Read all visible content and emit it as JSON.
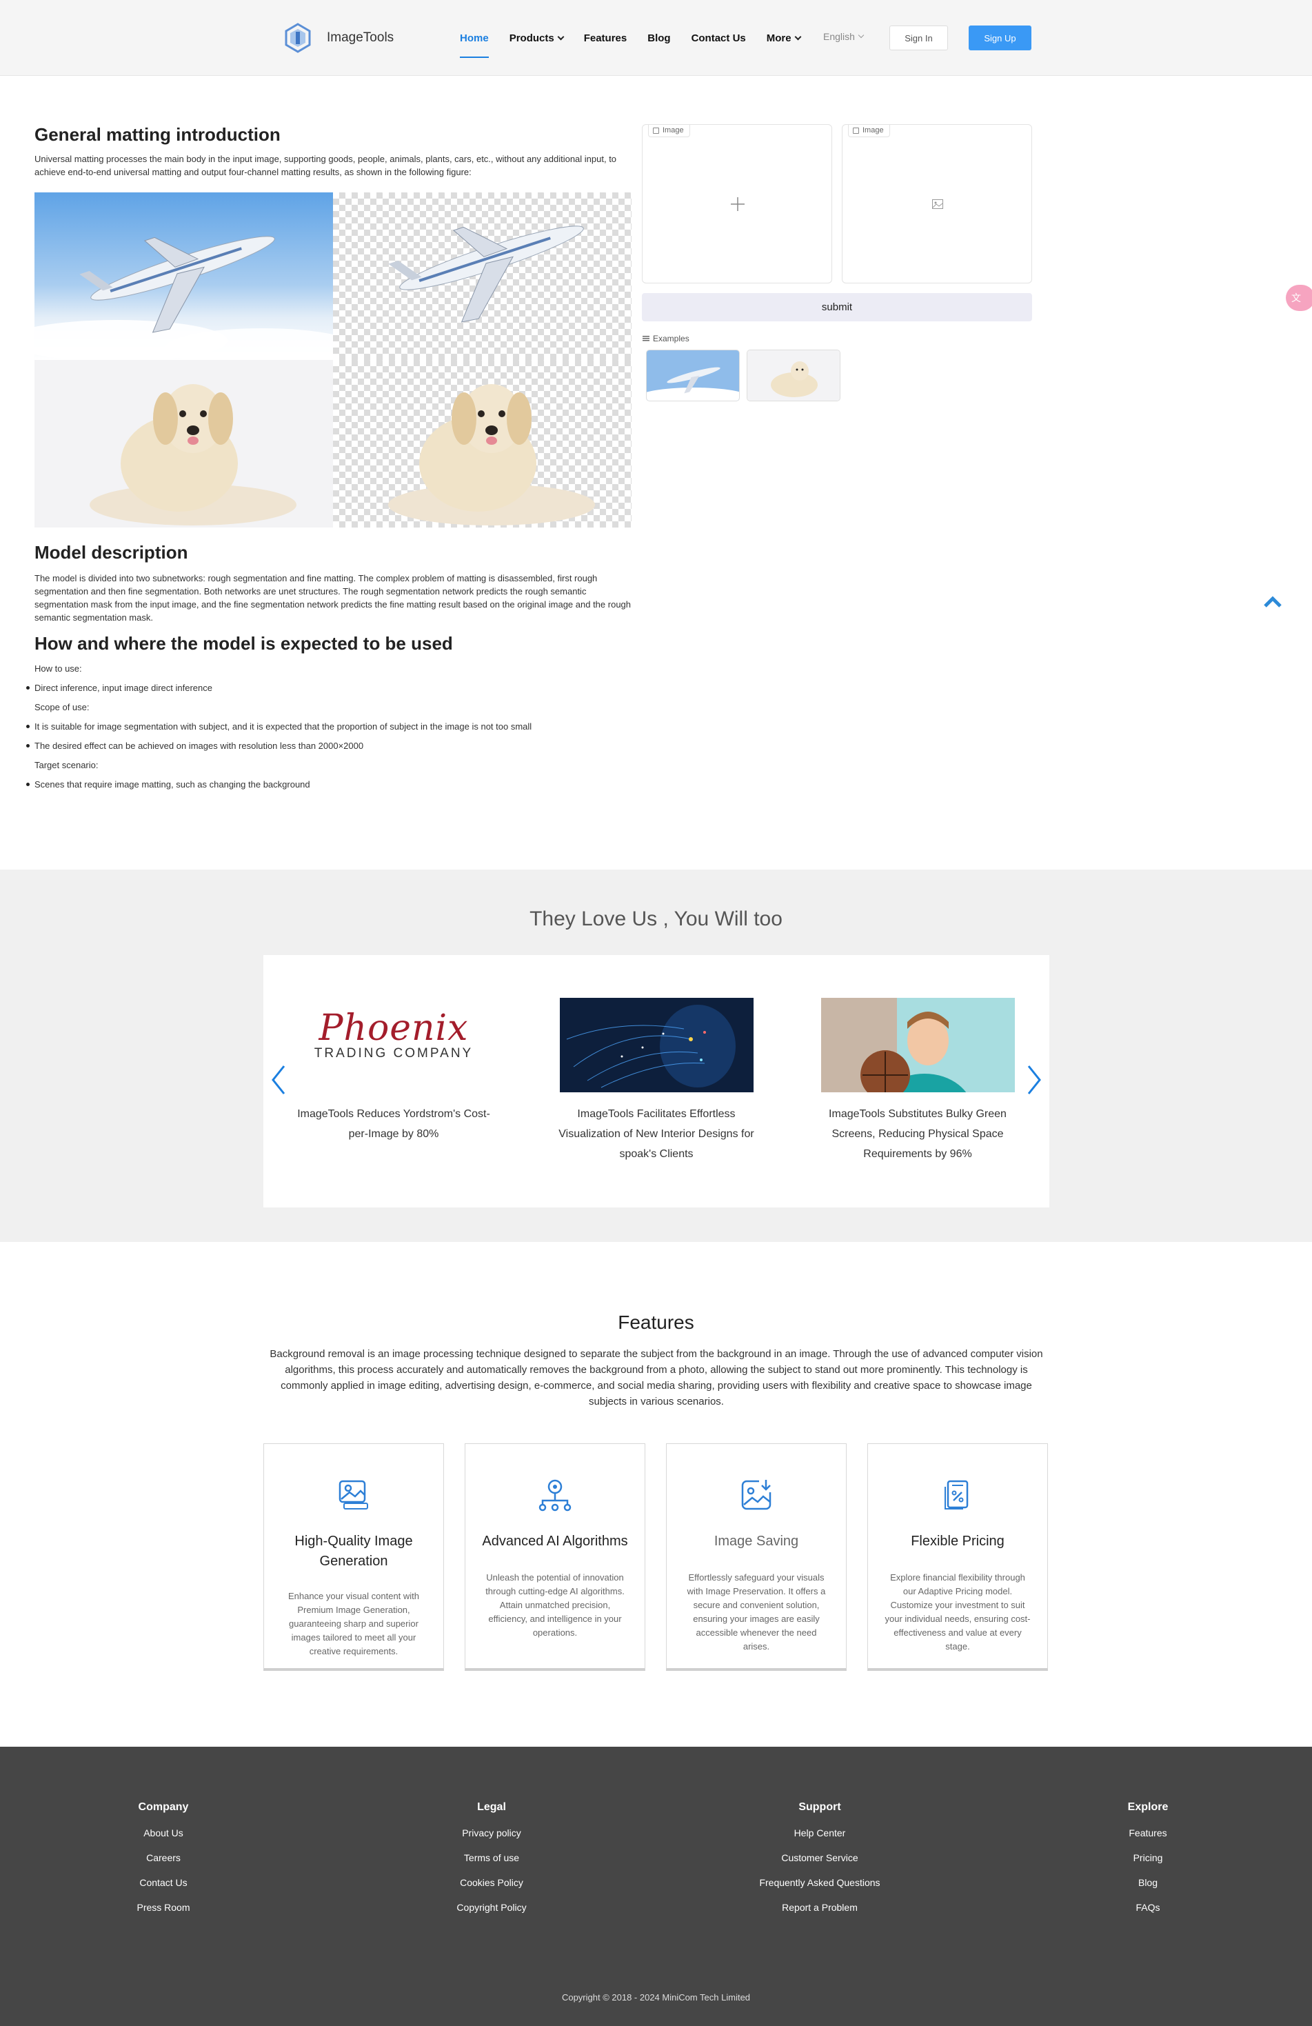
{
  "header": {
    "logo_text": "ImageTools",
    "nav": [
      {
        "label": "Home",
        "active": true,
        "dropdown": false
      },
      {
        "label": "Products",
        "active": false,
        "dropdown": true
      },
      {
        "label": "Features",
        "active": false,
        "dropdown": false
      },
      {
        "label": "Blog",
        "active": false,
        "dropdown": false
      },
      {
        "label": "Contact Us",
        "active": false,
        "dropdown": false
      },
      {
        "label": "More",
        "active": false,
        "dropdown": true
      }
    ],
    "language": "English",
    "sign_in": "Sign In",
    "sign_up": "Sign Up"
  },
  "intro": {
    "title": "General matting introduction",
    "text": "Universal matting processes the main body in the input image, supporting goods, people, animals, plants, cars, etc., without any additional input, to achieve end-to-end universal matting and output four-channel matting results, as shown in the following figure:"
  },
  "model": {
    "title": "Model description",
    "text": "The model is divided into two subnetworks: rough segmentation and fine matting. The complex problem of matting is disassembled, first rough segmentation and then fine segmentation. Both networks are unet structures. The rough segmentation network predicts the rough semantic segmentation mask from the input image, and the fine segmentation network predicts the fine matting result based on the original image and the rough semantic segmentation mask."
  },
  "usage": {
    "title": "How and where the model is expected to be used",
    "how_label": "How to use:",
    "how_items": [
      "Direct inference, input image direct inference"
    ],
    "scope_label": "Scope of use:",
    "scope_items": [
      "It is suitable for image segmentation with subject, and it is expected that the proportion of subject in the image is not too small",
      "The desired effect can be achieved on images with resolution less than 2000×2000"
    ],
    "target_label": "Target scenario:",
    "target_items": [
      "Scenes that require image matting, such as changing the background"
    ]
  },
  "panel": {
    "input_tag": "Image",
    "output_tag": "Image",
    "submit": "submit",
    "examples_label": "Examples"
  },
  "testimonials": {
    "title": "They Love Us , You Will too",
    "items": [
      {
        "logo_main": "Phoenix",
        "logo_sub": "TRADING COMPANY",
        "text": "ImageTools Reduces Yordstrom's Cost-per-Image by 80%"
      },
      {
        "text": "ImageTools Facilitates Effortless Visualization of New Interior Designs for spoak's Clients"
      },
      {
        "text": "ImageTools Substitutes Bulky Green Screens, Reducing Physical Space Requirements by 96%"
      }
    ]
  },
  "features": {
    "title": "Features",
    "description": "Background removal is an image processing technique designed to separate the subject from the background in an image. Through the use of advanced computer vision algorithms, this process accurately and automatically removes the background from a photo, allowing the subject to stand out more prominently. This technology is commonly applied in image editing, advertising design, e-commerce, and social media sharing, providing users with flexibility and creative space to showcase image subjects in various scenarios.",
    "cards": [
      {
        "icon": "image-quality-icon",
        "title": "High-Quality Image Generation",
        "text": "Enhance your visual content with Premium Image Generation, guaranteeing sharp and superior images tailored to meet all your creative requirements."
      },
      {
        "icon": "ai-network-icon",
        "title": "Advanced AI Algorithms",
        "text": "Unleash the potential of innovation through cutting-edge AI algorithms. Attain unmatched precision, efficiency, and intelligence in your operations."
      },
      {
        "icon": "image-save-icon",
        "title": "Image Saving",
        "text": "Effortlessly safeguard your visuals with Image Preservation. It offers a secure and convenient solution, ensuring your images are easily accessible whenever the need arises."
      },
      {
        "icon": "pricing-icon",
        "title": "Flexible Pricing",
        "text": "Explore financial flexibility through our Adaptive Pricing model. Customize your investment to suit your individual needs, ensuring cost-effectiveness and value at every stage."
      }
    ]
  },
  "footer": {
    "columns": [
      {
        "heading": "Company",
        "links": [
          "About Us",
          "Careers",
          "Contact Us",
          "Press Room"
        ]
      },
      {
        "heading": "Legal",
        "links": [
          "Privacy policy",
          "Terms of use",
          "Cookies Policy",
          "Copyright Policy"
        ]
      },
      {
        "heading": "Support",
        "links": [
          "Help Center",
          "Customer Service",
          "Frequently Asked Questions",
          "Report a Problem"
        ]
      },
      {
        "heading": "Explore",
        "links": [
          "Features",
          "Pricing",
          "Blog",
          "FAQs"
        ]
      }
    ],
    "copyright": "Copyright © 2018 - 2024 MiniCom Tech Limited"
  },
  "colors": {
    "accent": "#1b7fe0",
    "signup": "#3a99f5",
    "footer_bg": "#464646",
    "band_bg": "#f0f0f0"
  }
}
